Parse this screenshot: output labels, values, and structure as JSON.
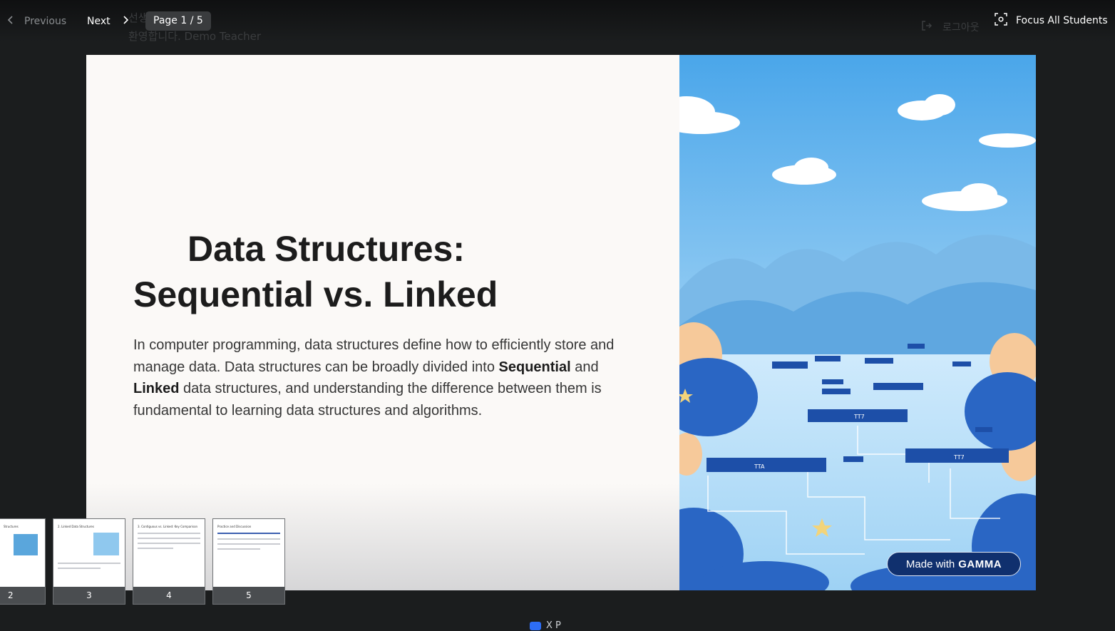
{
  "header": {
    "prev_label": "Previous",
    "next_label": "Next",
    "page_indicator": "Page 1 / 5",
    "bg_line1": "선생님",
    "bg_line2": "환영합니다. Demo Teacher",
    "logout_label": "로그아웃",
    "focus_label": "Focus All Students"
  },
  "slide": {
    "title_line1": "Data Structures:",
    "title_line2": "Sequential vs. Linked",
    "body_part1": "In computer programming, data structures define how to efficiently store and manage data. Data structures can be broadly divided into ",
    "body_bold1": "Sequential",
    "body_part2": " and ",
    "body_bold2": "Linked",
    "body_part3": " data structures, and understanding the difference between them is fundamental to learning data structures and algorithms.",
    "badge_prefix": "Made with",
    "badge_brand": "GAMMA",
    "illustration_labels": [
      "TTA",
      "TT7",
      "TT7"
    ]
  },
  "thumbnails": [
    {
      "num": "2",
      "title": "Structures"
    },
    {
      "num": "3",
      "title": "2. Linked Data Structures"
    },
    {
      "num": "4",
      "title": "3. Contiguous vs. Linked: Key Comparison"
    },
    {
      "num": "5",
      "title": "Practice and Discussion"
    }
  ],
  "footer": {
    "label": "X     P"
  },
  "colors": {
    "accent": "#2d6df6",
    "badge": "#10306e",
    "sky": "#56aee8"
  }
}
